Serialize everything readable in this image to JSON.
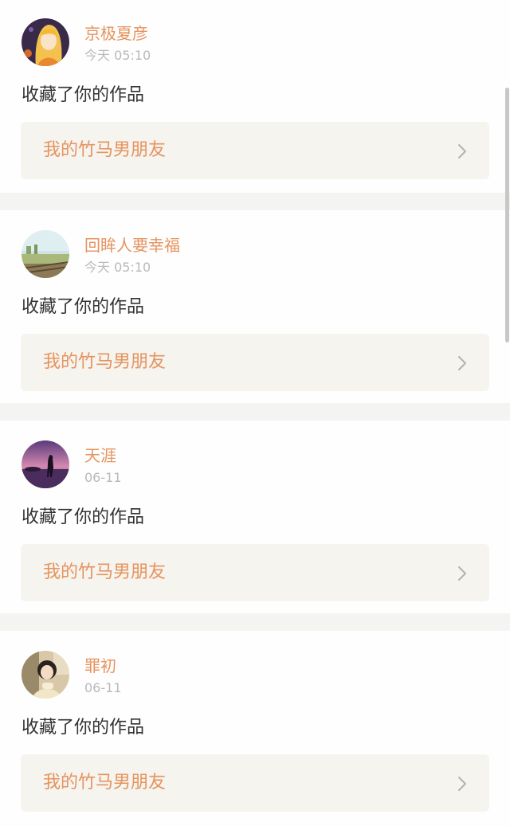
{
  "feed": {
    "items": [
      {
        "user": "京极夏彦",
        "time": "今天 05:10",
        "action": "收藏了你的作品",
        "work_title": "我的竹马男朋友",
        "avatar_icon": "anime-girl-avatar"
      },
      {
        "user": "回眸人要幸福",
        "time": "今天 05:10",
        "action": "收藏了你的作品",
        "work_title": "我的竹马男朋友",
        "avatar_icon": "landscape-avatar"
      },
      {
        "user": "天涯",
        "time": "06-11",
        "action": "收藏了你的作品",
        "work_title": "我的竹马男朋友",
        "avatar_icon": "sunset-silhouette-avatar"
      },
      {
        "user": "罪初",
        "time": "06-11",
        "action": "收藏了你的作品",
        "work_title": "我的竹马男朋友",
        "avatar_icon": "girl-photo-avatar"
      }
    ]
  },
  "colors": {
    "accent": "#e6935e",
    "muted": "#b9b9b9",
    "text": "#333333",
    "card_bg": "#f5f4ef",
    "divider": "#f4f4f2"
  }
}
